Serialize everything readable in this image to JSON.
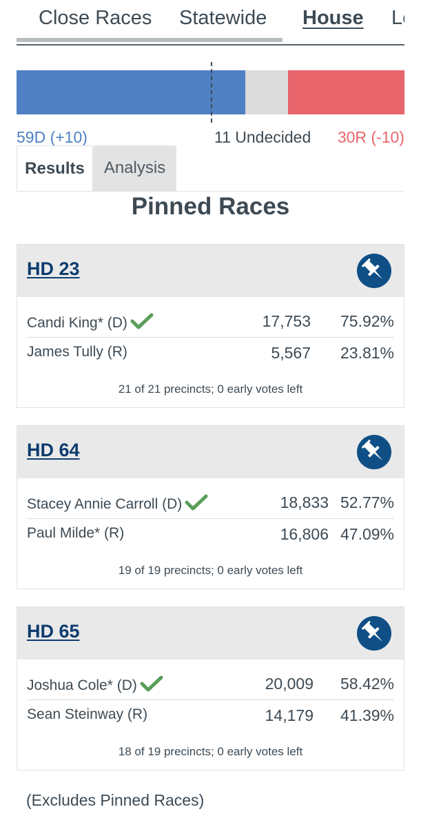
{
  "nav": {
    "tabs": [
      "Close Races",
      "Statewide",
      "House",
      "Le"
    ],
    "active": "House"
  },
  "seat_bar": {
    "dem_label": "59D (+10)",
    "undecided_label": "11 Undecided",
    "rep_label": "30R (-10)",
    "dem_seats": 59,
    "undecided_seats": 11,
    "rep_seats": 30,
    "colors": {
      "dem": "#4f80c3",
      "undecided": "#dcdcdc",
      "rep": "#e8656c"
    }
  },
  "subtabs": {
    "results": "Results",
    "analysis": "Analysis"
  },
  "section_title": "Pinned Races",
  "races": [
    {
      "name": "HD 23",
      "candidates": [
        {
          "name": "Candi King* (D)",
          "votes": "17,753",
          "pct": "75.92%",
          "winner": true
        },
        {
          "name": "James Tully (R)",
          "votes": "5,567",
          "pct": "23.81%",
          "winner": false
        }
      ],
      "precincts": "21 of 21 precincts; 0 early votes left"
    },
    {
      "name": "HD 64",
      "candidates": [
        {
          "name": "Stacey Annie Carroll (D)",
          "votes": "18,833",
          "pct": "52.77%",
          "winner": true
        },
        {
          "name": "Paul Milde* (R)",
          "votes": "16,806",
          "pct": "47.09%",
          "winner": false
        }
      ],
      "precincts": "19 of 19 precincts; 0 early votes left"
    },
    {
      "name": "HD 65",
      "candidates": [
        {
          "name": "Joshua Cole* (D)",
          "votes": "20,009",
          "pct": "58.42%",
          "winner": true
        },
        {
          "name": "Sean Steinway (R)",
          "votes": "14,179",
          "pct": "41.39%",
          "winner": false
        }
      ],
      "precincts": "18 of 19 precincts; 0 early votes left"
    }
  ],
  "footnote": "(Excludes Pinned Races)",
  "icons": {
    "pin": "pushpin-icon",
    "check": "checkmark-icon"
  },
  "accent_colors": {
    "link": "#0d3c6e",
    "pin_bg": "#0f4f86",
    "check": "#5a9e5a"
  }
}
